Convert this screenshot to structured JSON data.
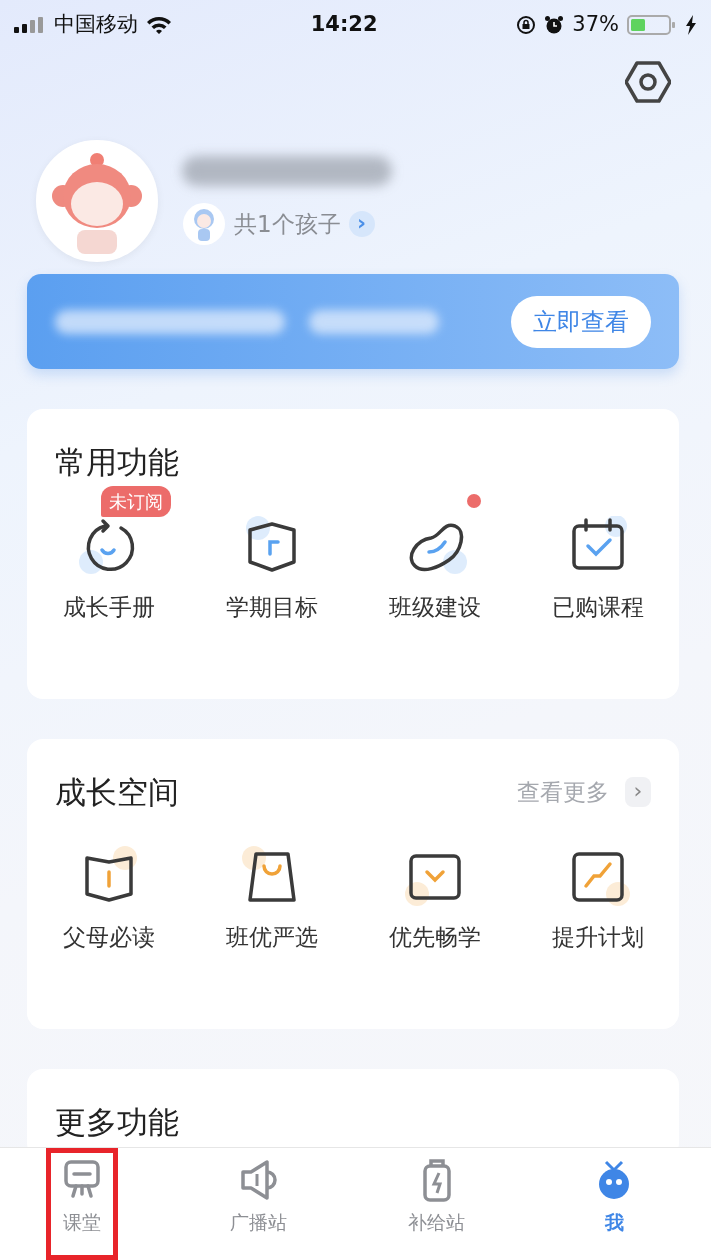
{
  "status_bar": {
    "carrier": "中国移动",
    "time": "14:22",
    "battery": "37%"
  },
  "profile": {
    "children_link": "共1个孩子",
    "chevron": "›"
  },
  "banner": {
    "button": "立即查看"
  },
  "sections": [
    {
      "title": "常用功能",
      "items": [
        {
          "label": "成长手册",
          "badge": "未订阅",
          "dot": false
        },
        {
          "label": "学期目标",
          "dot": false
        },
        {
          "label": "班级建设",
          "dot": true
        },
        {
          "label": "已购课程",
          "dot": false
        }
      ]
    },
    {
      "title": "成长空间",
      "more": "查看更多",
      "more_chevron": "›",
      "items": [
        {
          "label": "父母必读",
          "dot": false
        },
        {
          "label": "班优严选",
          "dot": false
        },
        {
          "label": "优先畅学",
          "dot": false
        },
        {
          "label": "提升计划",
          "dot": false
        }
      ]
    },
    {
      "title": "更多功能"
    }
  ],
  "tabs": [
    {
      "label": "课堂",
      "selected": false,
      "highlighted": true
    },
    {
      "label": "广播站",
      "selected": false,
      "highlighted": false
    },
    {
      "label": "补给站",
      "selected": false,
      "highlighted": false
    },
    {
      "label": "我",
      "selected": true,
      "highlighted": false
    }
  ]
}
